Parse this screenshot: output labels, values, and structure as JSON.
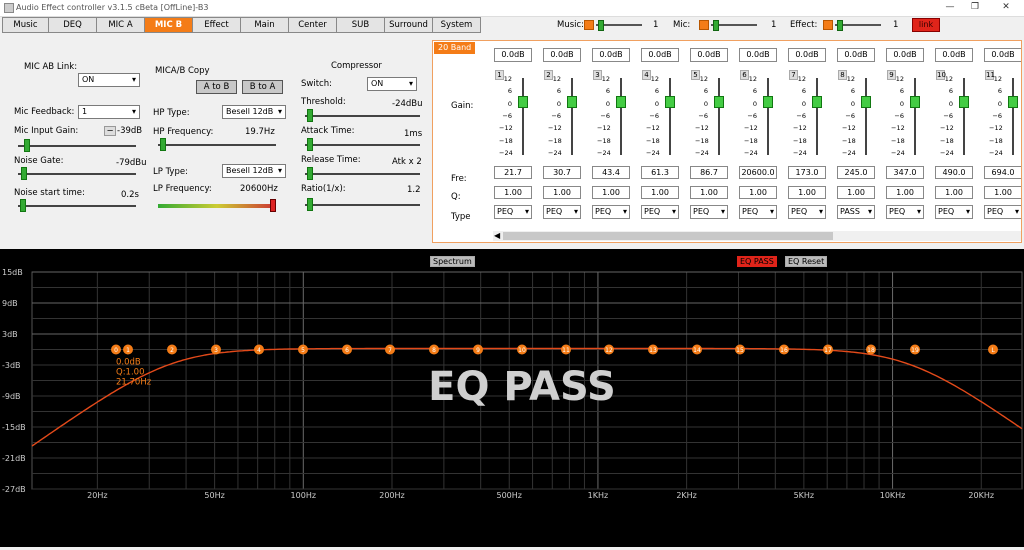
{
  "window": {
    "title": "Audio Effect controller v3.1.5 cBeta [OffLine]-B3",
    "min": "—",
    "max": "❐",
    "close": "✕"
  },
  "tabs": [
    "Music",
    "DEQ",
    "MIC A",
    "MIC B",
    "Effect",
    "Main",
    "Center",
    "SUB",
    "Surround",
    "System"
  ],
  "active_tab": "MIC B",
  "levels": [
    {
      "label": "Music:",
      "value": "1"
    },
    {
      "label": "Mic:",
      "value": "1"
    },
    {
      "label": "Effect:",
      "value": "1"
    }
  ],
  "link_button": "link",
  "colors": {
    "accent": "#f47c17",
    "curve": "#e34a1a",
    "link": "#e0241a",
    "slider": "#33aa33"
  },
  "mic": {
    "ab_link_label": "MIC AB Link:",
    "ab_link_value": "ON",
    "feedback_label": "Mic Feedback:",
    "feedback_value": "1",
    "input_gain_label": "Mic Input Gain:",
    "input_gain_value": "-39dB",
    "input_gain_level": 0.05,
    "noise_gate_label": "Noise Gate:",
    "noise_gate_value": "-79dBu",
    "noise_gate_level": 0.03,
    "noise_start_label": "Noise start time:",
    "noise_start_value": "0.2s",
    "noise_start_level": 0.02
  },
  "copy": {
    "label": "MICA/B Copy",
    "a_to_b": "A to B",
    "b_to_a": "B to A"
  },
  "filters": {
    "hp_type_label": "HP Type:",
    "hp_type_value": "Besell 12dB",
    "hp_freq_label": "HP Frequency:",
    "hp_freq_value": "19.7Hz",
    "hp_level": 0.02,
    "lp_type_label": "LP Type:",
    "lp_type_value": "Besell 12dB",
    "lp_freq_label": "LP Frequency:",
    "lp_freq_value": "20600Hz",
    "lp_level": 1.0
  },
  "compressor": {
    "title": "Compressor",
    "switch_label": "Switch:",
    "switch_value": "ON",
    "threshold_label": "Threshold:",
    "threshold_value": "-24dBu",
    "threshold_level": 0.02,
    "attack_label": "Attack Time:",
    "attack_value": "1ms",
    "attack_level": 0.02,
    "release_label": "Release Time:",
    "release_value": "Atk x 2",
    "release_level": 0.02,
    "ratio_label": "Ratio(1/x):",
    "ratio_value": "1.2",
    "ratio_level": 0.02
  },
  "eq": {
    "panel_title": "20 Band",
    "row_labels": {
      "gain": "Gain:",
      "fre": "Fre:",
      "q": "Q:",
      "type": "Type"
    },
    "scale": [
      "12",
      "6",
      "0",
      "−6",
      "−12",
      "−18",
      "−24"
    ],
    "bands": [
      {
        "n": "1",
        "gain": "0.0dB",
        "fre": "21.7",
        "q": "1.00",
        "type": "PEQ"
      },
      {
        "n": "2",
        "gain": "0.0dB",
        "fre": "30.7",
        "q": "1.00",
        "type": "PEQ"
      },
      {
        "n": "3",
        "gain": "0.0dB",
        "fre": "43.4",
        "q": "1.00",
        "type": "PEQ"
      },
      {
        "n": "4",
        "gain": "0.0dB",
        "fre": "61.3",
        "q": "1.00",
        "type": "PEQ"
      },
      {
        "n": "5",
        "gain": "0.0dB",
        "fre": "86.7",
        "q": "1.00",
        "type": "PEQ"
      },
      {
        "n": "6",
        "gain": "0.0dB",
        "fre": "20600.0",
        "q": "1.00",
        "type": "PEQ"
      },
      {
        "n": "7",
        "gain": "0.0dB",
        "fre": "173.0",
        "q": "1.00",
        "type": "PEQ"
      },
      {
        "n": "8",
        "gain": "0.0dB",
        "fre": "245.0",
        "q": "1.00",
        "type": "PASS"
      },
      {
        "n": "9",
        "gain": "0.0dB",
        "fre": "347.0",
        "q": "1.00",
        "type": "PEQ"
      },
      {
        "n": "10",
        "gain": "0.0dB",
        "fre": "490.0",
        "q": "1.00",
        "type": "PEQ"
      },
      {
        "n": "11",
        "gain": "0.0dB",
        "fre": "694.0",
        "q": "1.00",
        "type": "PEQ"
      }
    ]
  },
  "graph": {
    "spectrum_button": "Spectrum",
    "eq_pass_button": "EQ PASS",
    "eq_reset_button": "EQ Reset",
    "overlay_text": "EQ PASS",
    "readout": [
      "0.0dB",
      "Q:1.00",
      "21.70Hz"
    ],
    "y_labels": [
      "15dB",
      "9dB",
      "3dB",
      "-3dB",
      "-9dB",
      "-15dB",
      "-21dB",
      "-27dB"
    ],
    "x_labels": [
      "20Hz",
      "50Hz",
      "100Hz",
      "200Hz",
      "500Hz",
      "1KHz",
      "2KHz",
      "5KHz",
      "10KHz",
      "20KHz"
    ],
    "points": [
      "0",
      "1",
      "2",
      "3",
      "4",
      "5",
      "6",
      "7",
      "8",
      "9",
      "10",
      "11",
      "12",
      "13",
      "14",
      "15",
      "16",
      "17",
      "18",
      "19",
      "L"
    ]
  }
}
